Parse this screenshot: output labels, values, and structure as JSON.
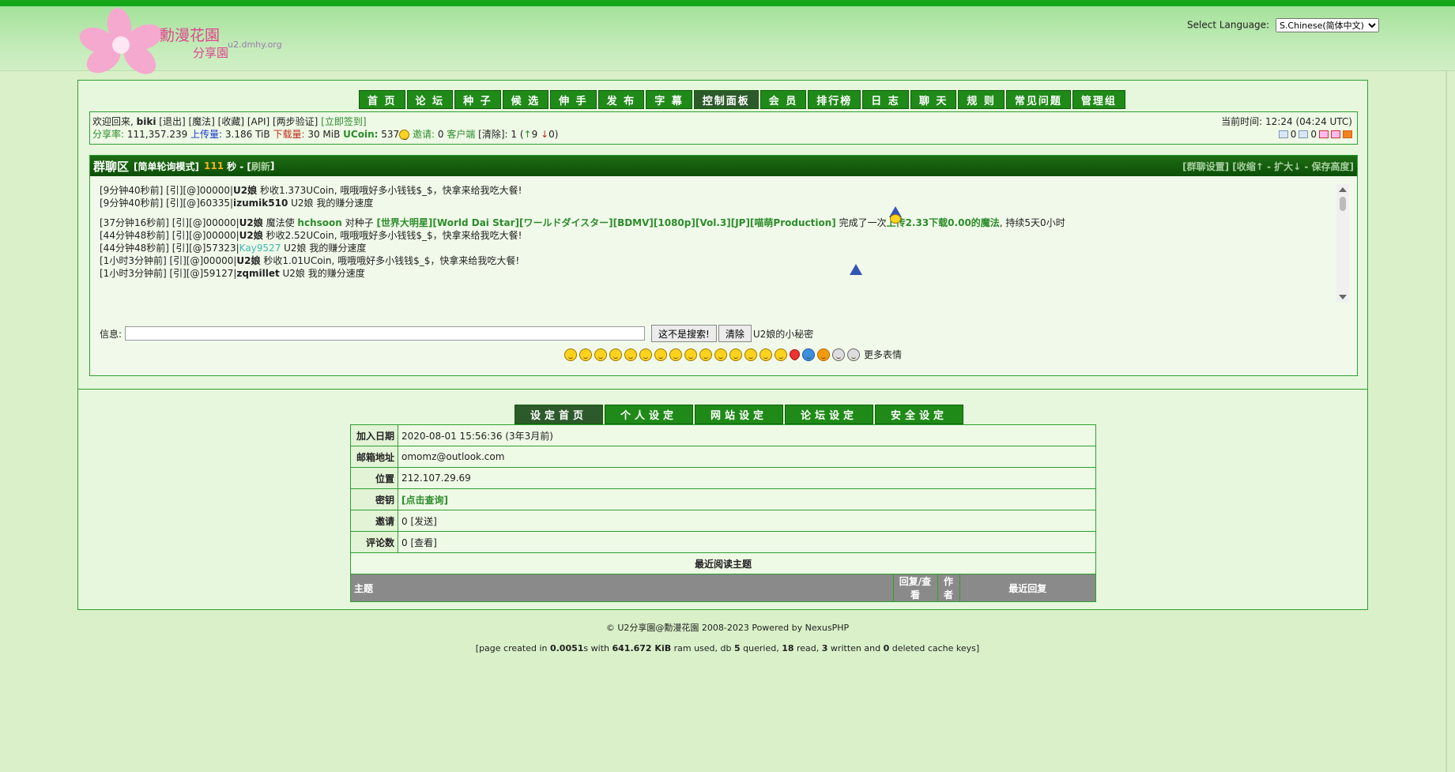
{
  "site": {
    "name": "勳漫花園",
    "sub": "分享園",
    "domain": "u2.dmhy.org"
  },
  "language": {
    "label": "Select Language:",
    "selected": "S.Chinese(简体中文)"
  },
  "nav": [
    "首 页",
    "论 坛",
    "种 子",
    "候 选",
    "伸 手",
    "发 布",
    "字 幕",
    "控制面板",
    "会 员",
    "排行榜",
    "日 志",
    "聊 天",
    "规 则",
    "常见问题",
    "管理组"
  ],
  "nav_active": "控制面板",
  "user": {
    "greeting": "欢迎回来,",
    "name": "biki",
    "links": "[退出] [魔法] [收藏] [API] [两步验证]",
    "checkin": "[立即签到]",
    "ratio_label": "分享率:",
    "ratio": "111,357.239",
    "upload_label": "上传量:",
    "upload": "3.186 TiB",
    "download_label": "下载量:",
    "download": "30 MiB",
    "ucoin_label": "UCoin:",
    "ucoin": "537",
    "invite_label": "邀请:",
    "invite": "0",
    "client_label": "客户端",
    "clear": "[清除]: 1 (",
    "seed": "9",
    "leech": "0",
    "clear_end": ")",
    "time_label": "当前时间:",
    "time": "12:24 (04:24 UTC)",
    "inbox": "0",
    "sent": "0"
  },
  "chat": {
    "title": "群聊区",
    "mode": "[简单轮询模式]",
    "countdown": "111",
    "unit": "秒 - [",
    "refresh": "刷新",
    "close": "]",
    "settings": "[群聊设置] [收缩↑ - 扩大↓ - 保存高度]",
    "lines": [
      {
        "pre": "[9分钟40秒前] [引][@]00000|",
        "name": "U2娘",
        "text": " 秒收1.373UCoin, 哦哦哦好多小钱钱$_$，快拿来给我吃大餐!"
      },
      {
        "pre": "[9分钟40秒前] [引][@]60335|",
        "name": "izumik510",
        "text": " U2娘 我的赚分速度"
      },
      {
        "pre": "[37分钟16秒前] [引][@]00000|",
        "name": "U2娘",
        "text": " 魔法使 ",
        "g1": "hchsoon",
        "t2": " 对种子 ",
        "g2": "[世界大明星][World Dai Star][ワールドダイスター][BDMV][1080p][Vol.3][JP][喵萌Production]",
        "t3": " 完成了一次",
        "g3": "上传2.33下载0.00的魔法",
        "t4": ", 持续5天0小时"
      },
      {
        "pre": "[44分钟48秒前] [引][@]00000|",
        "name": "U2娘",
        "text": " 秒收2.52UCoin, 哦哦哦好多小钱钱$_$，快拿来给我吃大餐!"
      },
      {
        "pre": "[44分钟48秒前] [引][@]57323|",
        "cyan": "Kay9527",
        "text": " U2娘 我的赚分速度"
      },
      {
        "pre": "[1小时3分钟前] [引][@]00000|",
        "name": "U2娘",
        "text": " 秒收1.01UCoin, 哦哦哦好多小钱钱$_$，快拿来给我吃大餐!"
      },
      {
        "pre": "[1小时3分钟前] [引][@]59127|",
        "name": "zqmillet",
        "text": " U2娘 我的赚分速度"
      }
    ],
    "input_label": "信息:",
    "input_value": "",
    "send": "这不是搜索!",
    "clear": "清除",
    "secret": "U2娘的小秘密",
    "more_emoji": "更多表情"
  },
  "settings_tabs": [
    "设定首页",
    "个人设定",
    "网站设定",
    "论坛设定",
    "安全设定"
  ],
  "profile": [
    {
      "label": "加入日期",
      "value": "2020-08-01 15:56:36 (3年3月前)"
    },
    {
      "label": "邮箱地址",
      "value": "omomz@outlook.com"
    },
    {
      "label": "位置",
      "value": "212.107.29.69"
    },
    {
      "label": "密钥",
      "value": "[点击查询]"
    },
    {
      "label": "邀请",
      "value": "0 [发送]"
    },
    {
      "label": "评论数",
      "value": "0 [查看]"
    }
  ],
  "recent": {
    "title": "最近阅读主题",
    "headers": [
      "主题",
      "回复/查看",
      "作者",
      "最近回复"
    ]
  },
  "footer": {
    "copyright": "© U2分享園@勳漫花園 2008-2023 Powered by NexusPHP",
    "stats_pre": "[page created in ",
    "time": "0.0051",
    "stats_mid1": "s with ",
    "ram": "641.672 KiB",
    "stats_mid2": " ram used, db ",
    "queried": "5",
    "stats_mid3": " queried, ",
    "read": "18",
    "stats_mid4": " read, ",
    "written": "3",
    "stats_mid5": " written and ",
    "deleted": "0",
    "stats_end": " deleted cache keys]"
  }
}
